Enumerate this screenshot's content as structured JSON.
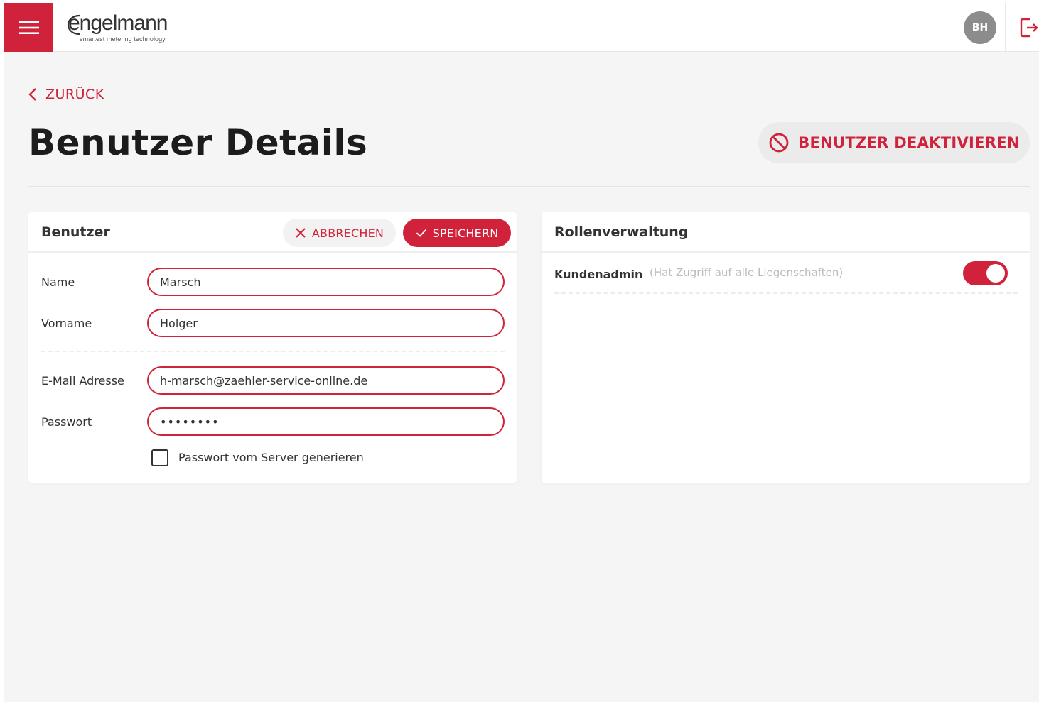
{
  "header": {
    "logo_main": "engelmann",
    "logo_sub": "smartest metering technology",
    "avatar_initials": "BH"
  },
  "page": {
    "back_label": "ZURÜCK",
    "title": "Benutzer Details",
    "deactivate_label": "BENUTZER DEAKTIVIEREN"
  },
  "user_card": {
    "title": "Benutzer",
    "cancel_label": "ABBRECHEN",
    "save_label": "SPEICHERN",
    "fields": {
      "name": {
        "label": "Name",
        "value": "Marsch"
      },
      "vorname": {
        "label": "Vorname",
        "value": "Holger"
      },
      "email": {
        "label": "E-Mail Adresse",
        "value": "h-marsch@zaehler-service-online.de"
      },
      "password": {
        "label": "Passwort",
        "value": "••••••••"
      }
    },
    "generate_password_label": "Passwort vom Server generieren",
    "generate_password_checked": false
  },
  "roles_card": {
    "title": "Rollenverwaltung",
    "roles": [
      {
        "name": "Kundenadmin",
        "description": "(Hat Zugriff auf alle Liegenschaften)",
        "enabled": true
      }
    ]
  },
  "colors": {
    "accent": "#d0223a",
    "background": "#f5f5f5",
    "avatar": "#8c8c8c"
  },
  "icons": {
    "menu": "hamburger-icon",
    "logout": "logout-icon",
    "back": "chevron-left-icon",
    "deactivate": "ban-icon",
    "cancel": "close-icon",
    "save": "check-icon"
  }
}
